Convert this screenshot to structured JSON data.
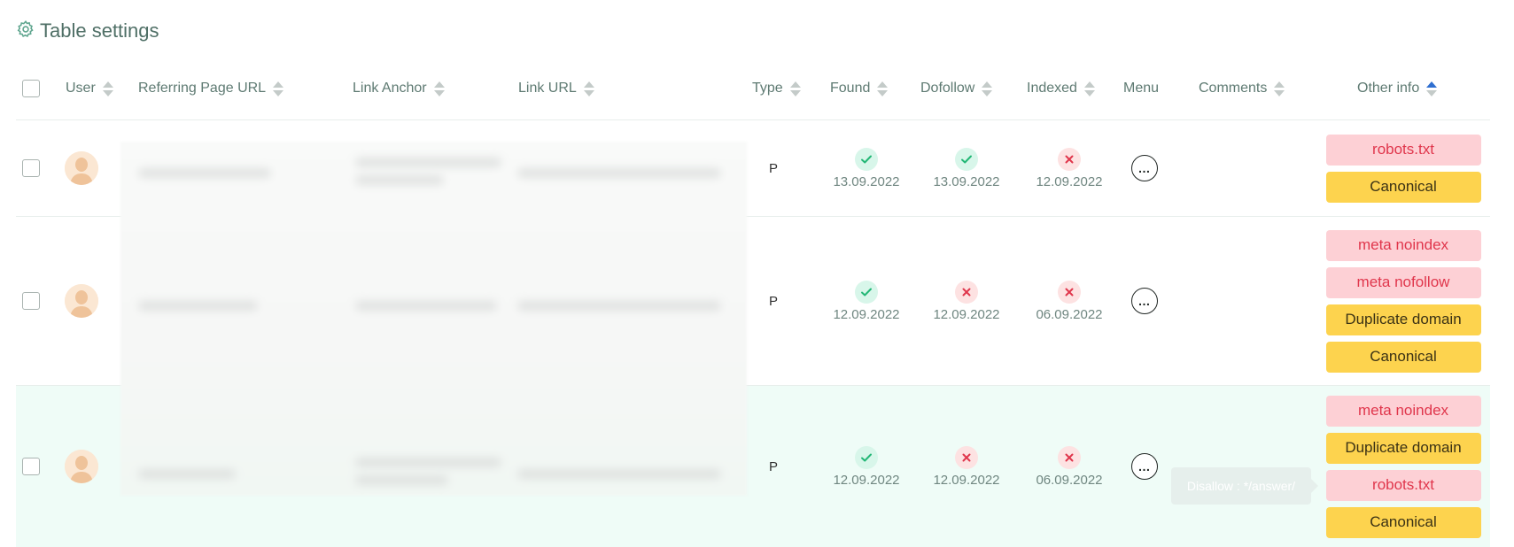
{
  "header": {
    "title": "Table settings"
  },
  "columns": {
    "user": "User",
    "referring": "Referring Page URL",
    "anchor": "Link Anchor",
    "link_url": "Link URL",
    "type": "Type",
    "found": "Found",
    "dofollow": "Dofollow",
    "indexed": "Indexed",
    "menu": "Menu",
    "comments": "Comments",
    "other": "Other info"
  },
  "sort": {
    "active_column": "Other info",
    "direction": "ascending"
  },
  "rows": [
    {
      "type": "P",
      "found": {
        "ok": true,
        "date": "13.09.2022"
      },
      "dofollow": {
        "ok": true,
        "date": "13.09.2022"
      },
      "indexed": {
        "ok": false,
        "date": "12.09.2022"
      },
      "menu_icon": "…",
      "tags": [
        "robots.txt",
        "Canonical"
      ]
    },
    {
      "type": "P",
      "found": {
        "ok": true,
        "date": "12.09.2022"
      },
      "dofollow": {
        "ok": false,
        "date": "12.09.2022"
      },
      "indexed": {
        "ok": false,
        "date": "06.09.2022"
      },
      "menu_icon": "…",
      "tags": [
        "meta noindex",
        "meta nofollow",
        "Duplicate domain",
        "Canonical"
      ]
    },
    {
      "type": "P",
      "found": {
        "ok": true,
        "date": "12.09.2022"
      },
      "dofollow": {
        "ok": false,
        "date": "12.09.2022"
      },
      "indexed": {
        "ok": false,
        "date": "06.09.2022"
      },
      "menu_icon": "…",
      "tags": [
        "meta noindex",
        "Duplicate domain",
        "robots.txt",
        "Canonical"
      ]
    }
  ],
  "tooltip": {
    "text": "Disallow : */answer/"
  },
  "colors": {
    "ok_bg": "#d8f6ea",
    "ok_icon": "#23b776",
    "no_bg": "#fde2e2",
    "no_icon": "#e0364c",
    "tag_red_bg": "#fdd0d5",
    "tag_red_text": "#e0364c",
    "tag_yellow_bg": "#fdd34e",
    "selected_row_bg": "#effcf7",
    "sort_active": "#2f6fd0"
  },
  "icons": {
    "settings": "gear-icon",
    "check": "check-icon",
    "cross": "cross-icon",
    "menu": "ellipsis-icon",
    "avatar": "user-avatar-icon",
    "sort": "sort-arrows-icon"
  }
}
